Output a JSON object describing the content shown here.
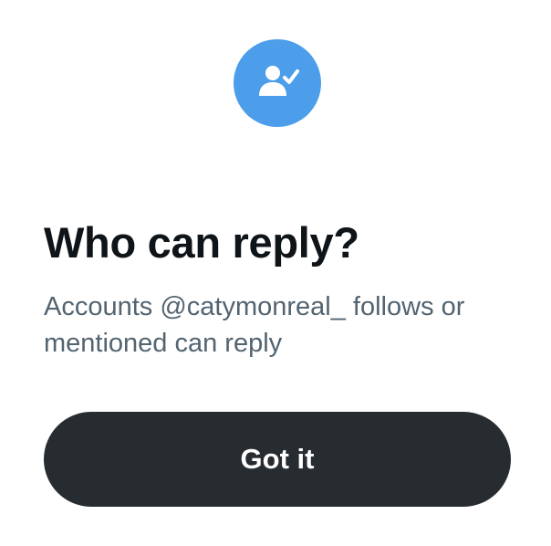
{
  "dialog": {
    "icon": "person-check-icon",
    "accent_color": "#4c9eeb",
    "title": "Who can reply?",
    "subtitle": "Accounts @catymonreal_ follows or mentioned can reply",
    "button_label": "Got it",
    "button_color": "#272c30"
  }
}
